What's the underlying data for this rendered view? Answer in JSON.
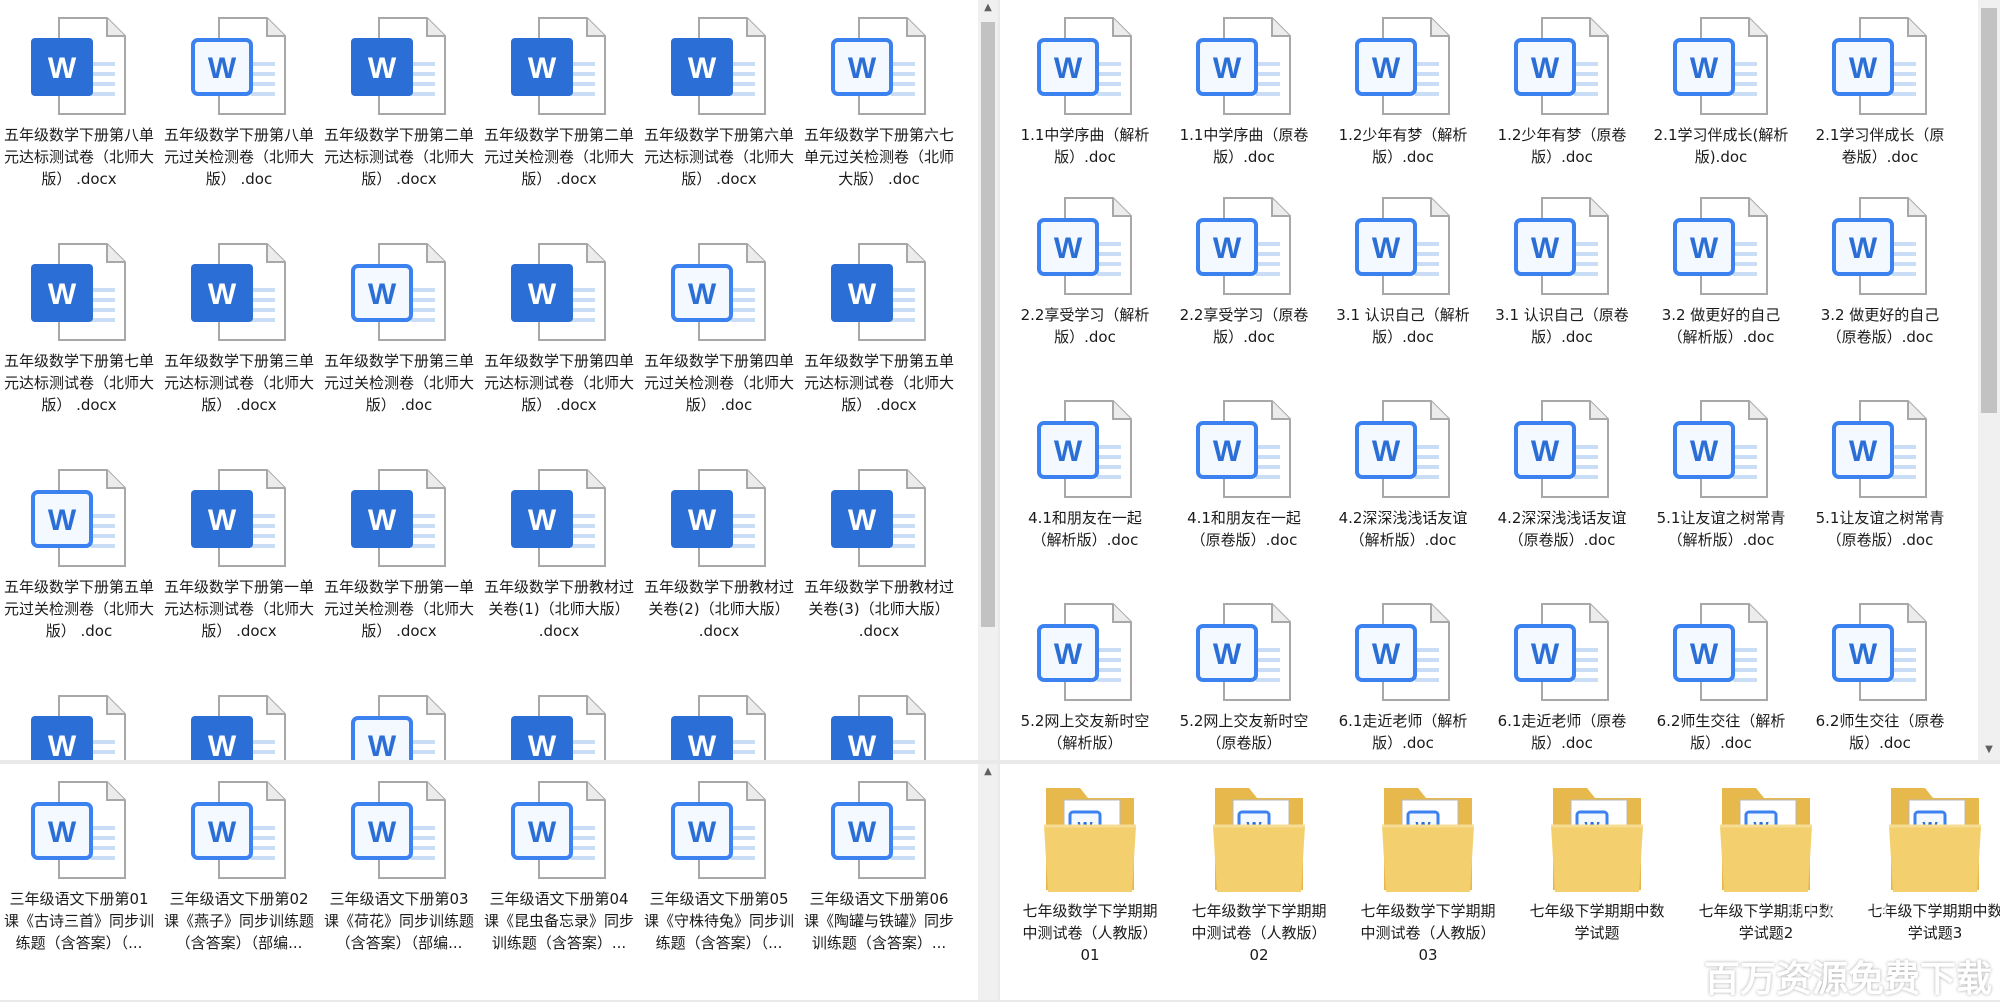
{
  "colors": {
    "word_blue": "#2b6fd6",
    "word_blue_light": "#3b82f0",
    "folder_yellow": "#f3cf6e",
    "selection": "#cce4f7"
  },
  "icons": {
    "file": "word-document-icon",
    "folder": "folder-icon"
  },
  "word_letter": "W",
  "top_left_files": [
    {
      "name": "五年级数学下册第八单元达标测试卷（北师大版） .docx",
      "style": "solid"
    },
    {
      "name": "五年级数学下册第八单元过关检测卷（北师大版） .doc",
      "style": "outline"
    },
    {
      "name": "五年级数学下册第二单元达标测试卷（北师大版） .docx",
      "style": "solid"
    },
    {
      "name": "五年级数学下册第二单元过关检测卷（北师大版） .docx",
      "style": "solid"
    },
    {
      "name": "五年级数学下册第六单元达标测试卷（北师大版） .docx",
      "style": "solid"
    },
    {
      "name": "五年级数学下册第六七单元过关检测卷（北师大版） .doc",
      "style": "outline"
    },
    {
      "name": "五年级数学下册第七单元达标测试卷（北师大版） .docx",
      "style": "solid"
    },
    {
      "name": "五年级数学下册第三单元达标测试卷（北师大版） .docx",
      "style": "solid"
    },
    {
      "name": "五年级数学下册第三单元过关检测卷（北师大版） .doc",
      "style": "outline"
    },
    {
      "name": "五年级数学下册第四单元达标测试卷（北师大版） .docx",
      "style": "solid"
    },
    {
      "name": "五年级数学下册第四单元过关检测卷（北师大版） .doc",
      "style": "outline"
    },
    {
      "name": "五年级数学下册第五单元达标测试卷（北师大版） .docx",
      "style": "solid"
    },
    {
      "name": "五年级数学下册第五单元过关检测卷（北师大版） .doc",
      "style": "outline"
    },
    {
      "name": "五年级数学下册第一单元达标测试卷（北师大版） .docx",
      "style": "solid"
    },
    {
      "name": "五年级数学下册第一单元过关检测卷（北师大版） .docx",
      "style": "solid"
    },
    {
      "name": "五年级数学下册教材过关卷(1)（北师大版） .docx",
      "style": "solid"
    },
    {
      "name": "五年级数学下册教材过关卷(2)（北师大版） .docx",
      "style": "solid"
    },
    {
      "name": "五年级数学下册教材过关卷(3)（北师大版） .docx",
      "style": "solid"
    },
    {
      "name": "",
      "style": "solid"
    },
    {
      "name": "",
      "style": "solid"
    },
    {
      "name": "",
      "style": "outline"
    },
    {
      "name": "",
      "style": "solid"
    },
    {
      "name": "",
      "style": "solid"
    },
    {
      "name": "",
      "style": "solid"
    }
  ],
  "bottom_left_files": [
    {
      "name": "三年级语文下册第01课《古诗三首》同步训练题（含答案）（...",
      "style": "outline"
    },
    {
      "name": "三年级语文下册第02课《燕子》同步训练题（含答案）（部编...",
      "style": "outline"
    },
    {
      "name": "三年级语文下册第03课《荷花》同步训练题（含答案）（部编...",
      "style": "outline"
    },
    {
      "name": "三年级语文下册第04课《昆虫备忘录》同步训练题（含答案）...",
      "style": "outline"
    },
    {
      "name": "三年级语文下册第05课《守株待兔》同步训练题（含答案）（...",
      "style": "outline"
    },
    {
      "name": "三年级语文下册第06课《陶罐与铁罐》同步训练题（含答案）...",
      "style": "outline"
    }
  ],
  "top_right_files": [
    {
      "name": "1.1中学序曲（解析版）.doc"
    },
    {
      "name": "1.1中学序曲（原卷版）.doc"
    },
    {
      "name": "1.2少年有梦（解析版）.doc"
    },
    {
      "name": "1.2少年有梦（原卷版）.doc"
    },
    {
      "name": "2.1学习伴成长(解析版).doc"
    },
    {
      "name": "2.1学习伴成长（原卷版）.doc"
    },
    {
      "name": "2.2享受学习（解析版）.doc"
    },
    {
      "name": "2.2享受学习（原卷版）.doc"
    },
    {
      "name": "3.1 认识自己（解析版）.doc"
    },
    {
      "name": "3.1 认识自己（原卷版）.doc"
    },
    {
      "name": "3.2 做更好的自己（解析版）.doc"
    },
    {
      "name": "3.2 做更好的自己（原卷版）.doc"
    },
    {
      "name": "4.1和朋友在一起（解析版）.doc"
    },
    {
      "name": "4.1和朋友在一起（原卷版）.doc"
    },
    {
      "name": "4.2深深浅浅话友谊（解析版）.doc"
    },
    {
      "name": "4.2深深浅浅话友谊（原卷版）.doc"
    },
    {
      "name": "5.1让友谊之树常青（解析版）.doc"
    },
    {
      "name": "5.1让友谊之树常青（原卷版）.doc"
    },
    {
      "name": "5.2网上交友新时空（解析版）"
    },
    {
      "name": "5.2网上交友新时空（原卷版）"
    },
    {
      "name": "6.1走近老师（解析版）.doc"
    },
    {
      "name": "6.1走近老师（原卷版）.doc"
    },
    {
      "name": "6.2师生交往（解析版）.doc"
    },
    {
      "name": "6.2师生交往（原卷版）.doc"
    }
  ],
  "bottom_right_folders": [
    {
      "name": "七年级数学下学期期中测试卷（人教版）01"
    },
    {
      "name": "七年级数学下学期期中测试卷（人教版）02"
    },
    {
      "name": "七年级数学下学期期中测试卷（人教版）03"
    },
    {
      "name": "七年级下学期期中数学试题"
    },
    {
      "name": "七年级下学期期中数学试题2"
    },
    {
      "name": "七年级下学期期中数学试题3"
    }
  ],
  "watermark": {
    "url": "niquan",
    "text": "百万资源免费下载"
  }
}
